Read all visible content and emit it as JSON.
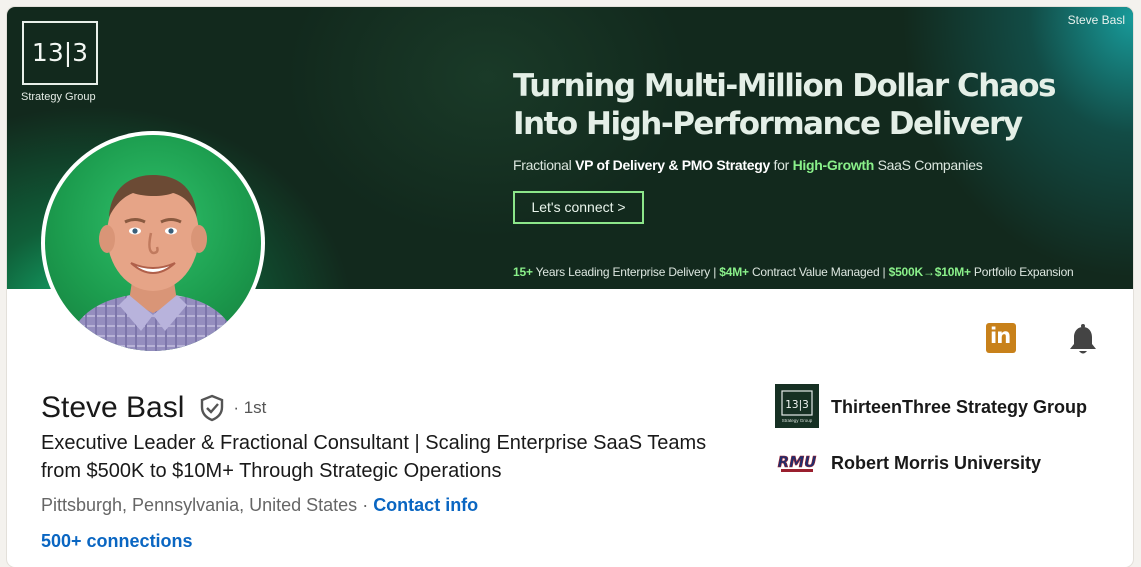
{
  "banner": {
    "logo_text": "13|3",
    "logo_sub": "Strategy Group",
    "name": "Steve Basl",
    "headline_line1": "Turning Multi-Million Dollar Chaos",
    "headline_line2": "Into High-Performance Delivery",
    "tagline": {
      "part1": "Fractional ",
      "part2": "VP of Delivery & PMO Strategy",
      "part3": " for ",
      "part4": "High-Growth",
      "part5": " SaaS Companies"
    },
    "cta_label": "Let's connect >",
    "stats": {
      "s1": "15+",
      "s2": " Years Leading Enterprise Delivery | ",
      "s3": "$4M+",
      "s4": " Contract Value Managed  |  ",
      "s5": "$500K→$10M+",
      "s6": " Portfolio Expansion"
    },
    "colors": {
      "background": "#12291d",
      "accent": "#8af08a"
    }
  },
  "profile": {
    "name": "Steve Basl",
    "degree": "· 1st",
    "headline": "Executive Leader & Fractional Consultant | Scaling Enterprise SaaS Teams from $500K to $10M+ Through Strategic Operations",
    "location": "Pittsburgh, Pennsylvania, United States",
    "separator": " · ",
    "contact_info": "Contact info",
    "connections": "500+ connections"
  },
  "actions": {
    "linkedin_icon": "linkedin-icon",
    "linkedin_text": "in",
    "bell_icon": "bell-icon"
  },
  "experience": {
    "company": "ThirteenThree Strategy Group",
    "company_logo_text": "13|3",
    "company_logo_sub": "Strategy Group",
    "school": "Robert Morris University",
    "school_logo_text": "RMU"
  },
  "colors": {
    "link": "#0a66c2",
    "linkedin_badge": "#c8811a"
  }
}
